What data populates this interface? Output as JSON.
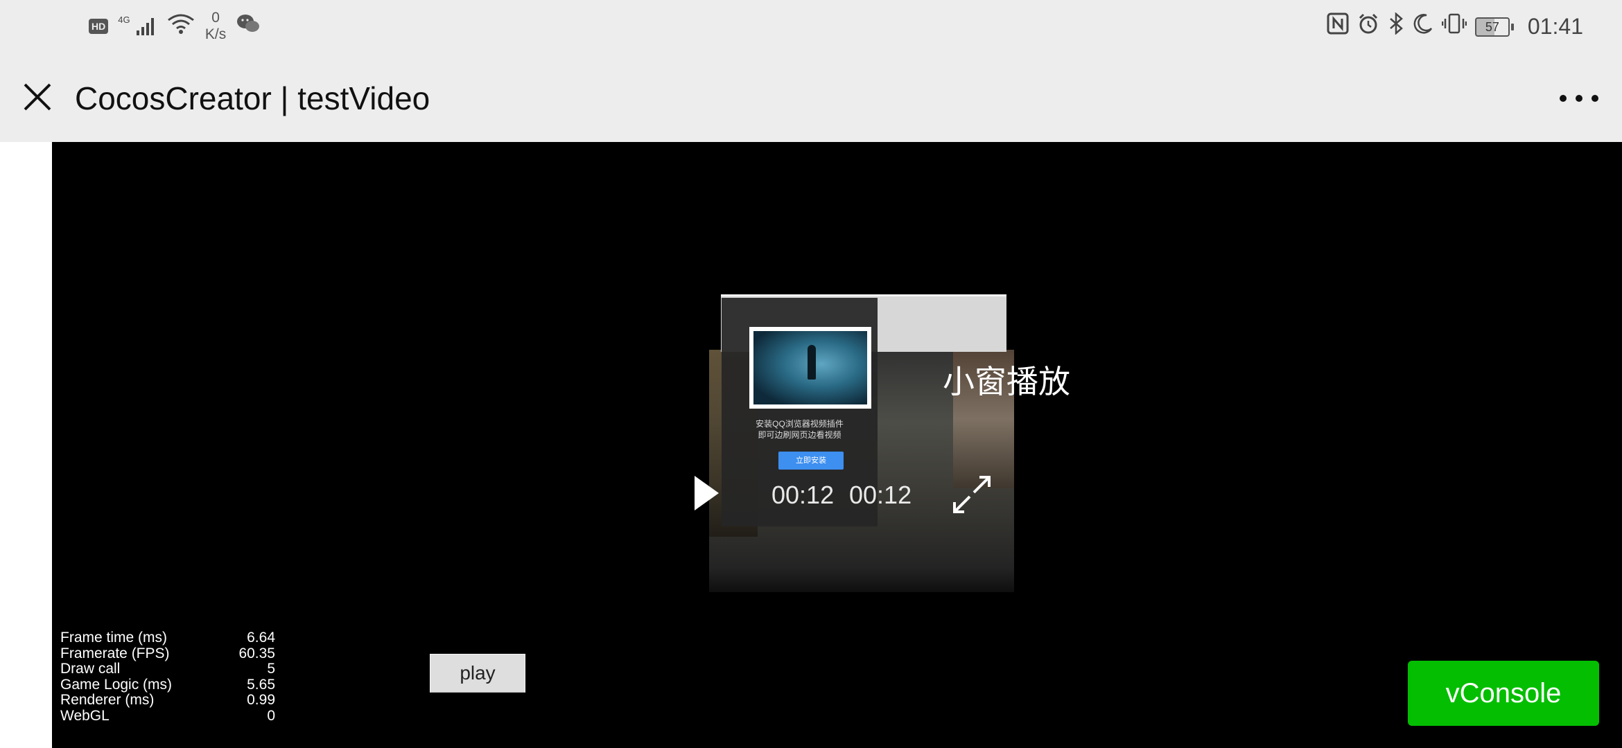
{
  "status_bar": {
    "hd_badge": "HD",
    "network_type": "4G",
    "speed_value": "0",
    "speed_unit": "K/s",
    "battery_level": "57",
    "time": "01:41",
    "icons": [
      "hd-icon",
      "cellular-signal-icon",
      "wifi-icon",
      "wechat-icon",
      "nfc-icon",
      "alarm-icon",
      "bluetooth-icon",
      "moon-icon",
      "vibrate-icon",
      "battery-icon"
    ]
  },
  "title_bar": {
    "title": "CocosCreator | testVideo"
  },
  "video": {
    "pip_label": "小窗播放",
    "current_time": "00:12",
    "total_time": "00:12",
    "promo": {
      "line1": "安装QQ浏览器视频插件",
      "line2": "即可边刷网页边看视频",
      "button_label": "立即安装"
    }
  },
  "stats": [
    {
      "label": "Frame time (ms)",
      "value": "6.64"
    },
    {
      "label": "Framerate (FPS)",
      "value": "60.35"
    },
    {
      "label": "Draw call",
      "value": "5"
    },
    {
      "label": "Game Logic (ms)",
      "value": "5.65"
    },
    {
      "label": "Renderer (ms)",
      "value": "0.99"
    },
    {
      "label": "WebGL",
      "value": "0"
    }
  ],
  "buttons": {
    "play_label": "play",
    "vconsole_label": "vConsole"
  },
  "colors": {
    "titlebar_bg": "#ededed",
    "game_bg": "#000000",
    "vconsole_green": "#04be02",
    "promo_button_blue": "#3d8ff0"
  }
}
